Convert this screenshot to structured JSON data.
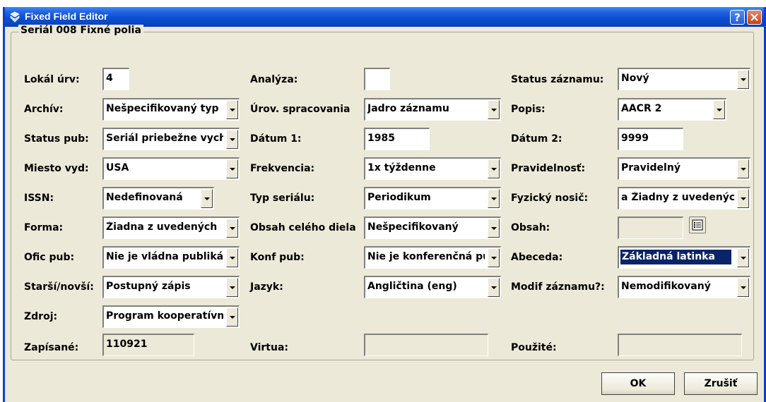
{
  "window": {
    "title": "Fixed Field Editor"
  },
  "group": {
    "title": "Seriál 008 Fixné polia"
  },
  "fields": {
    "lokal_urv": {
      "label": "Lokál úrv:",
      "value": "4"
    },
    "analyza": {
      "label": "Analýza:",
      "value": ""
    },
    "status_zaznamu": {
      "label": "Status záznamu:",
      "value": "Nový"
    },
    "archiv": {
      "label": "Archív:",
      "value": "Nešpecifikovaný typ"
    },
    "urov_spracovania": {
      "label": "Úrov. spracovania",
      "value": "Jadro záznamu"
    },
    "popis": {
      "label": "Popis:",
      "value": "AACR 2"
    },
    "status_pub": {
      "label": "Status pub:",
      "value": "Seriál priebežne vychádza"
    },
    "datum1": {
      "label": "Dátum 1:",
      "value": "1985"
    },
    "datum2": {
      "label": "Dátum 2:",
      "value": "9999"
    },
    "miesto_vyd": {
      "label": "Miesto vyd:",
      "value": "USA"
    },
    "frekvencia": {
      "label": "Frekvencia:",
      "value": "1x týždenne"
    },
    "pravidelnost": {
      "label": "Pravidelnosť:",
      "value": "Pravidelný"
    },
    "issn": {
      "label": "ISSN:",
      "value": "Nedefinovaná"
    },
    "typ_serialu": {
      "label": "Typ seriálu:",
      "value": "Periodikum"
    },
    "fyzicky_nosic": {
      "label": "Fyzický nosič:",
      "value": "a Žiadny z uvedených"
    },
    "forma": {
      "label": "Forma:",
      "value": "Žiadna z uvedených"
    },
    "obsah_celeho_diela": {
      "label": "Obsah celého diela",
      "value": "Nešpecifikovaný"
    },
    "obsah": {
      "label": "Obsah:",
      "value": ""
    },
    "ofic_pub": {
      "label": "Ofic pub:",
      "value": "Nie je vládna publikácia"
    },
    "konf_pub": {
      "label": "Konf pub:",
      "value": "Nie je konferenčná publikácia"
    },
    "abeceda": {
      "label": "Abeceda:",
      "value": "Základná latinka"
    },
    "starsi_novsi": {
      "label": "Starší/novší:",
      "value": "Postupný zápis"
    },
    "jazyk": {
      "label": "Jazyk:",
      "value": "Angličtina (eng)"
    },
    "modif_zaznamu": {
      "label": "Modif záznamu?:",
      "value": "Nemodifikovaný"
    },
    "zdroj": {
      "label": "Zdroj:",
      "value": "Program kooperatívnej katalogizácie"
    },
    "zapisane": {
      "label": "Zapísané:",
      "value": "110921"
    },
    "virtua": {
      "label": "Virtua:",
      "value": ""
    },
    "pouzite": {
      "label": "Použité:",
      "value": ""
    }
  },
  "buttons": {
    "ok": "OK",
    "cancel": "Zrušiť"
  },
  "colors": {
    "titlebar": "#0a47c4",
    "dialog_bg": "#ECE9D8",
    "selection": "#0a246a"
  }
}
